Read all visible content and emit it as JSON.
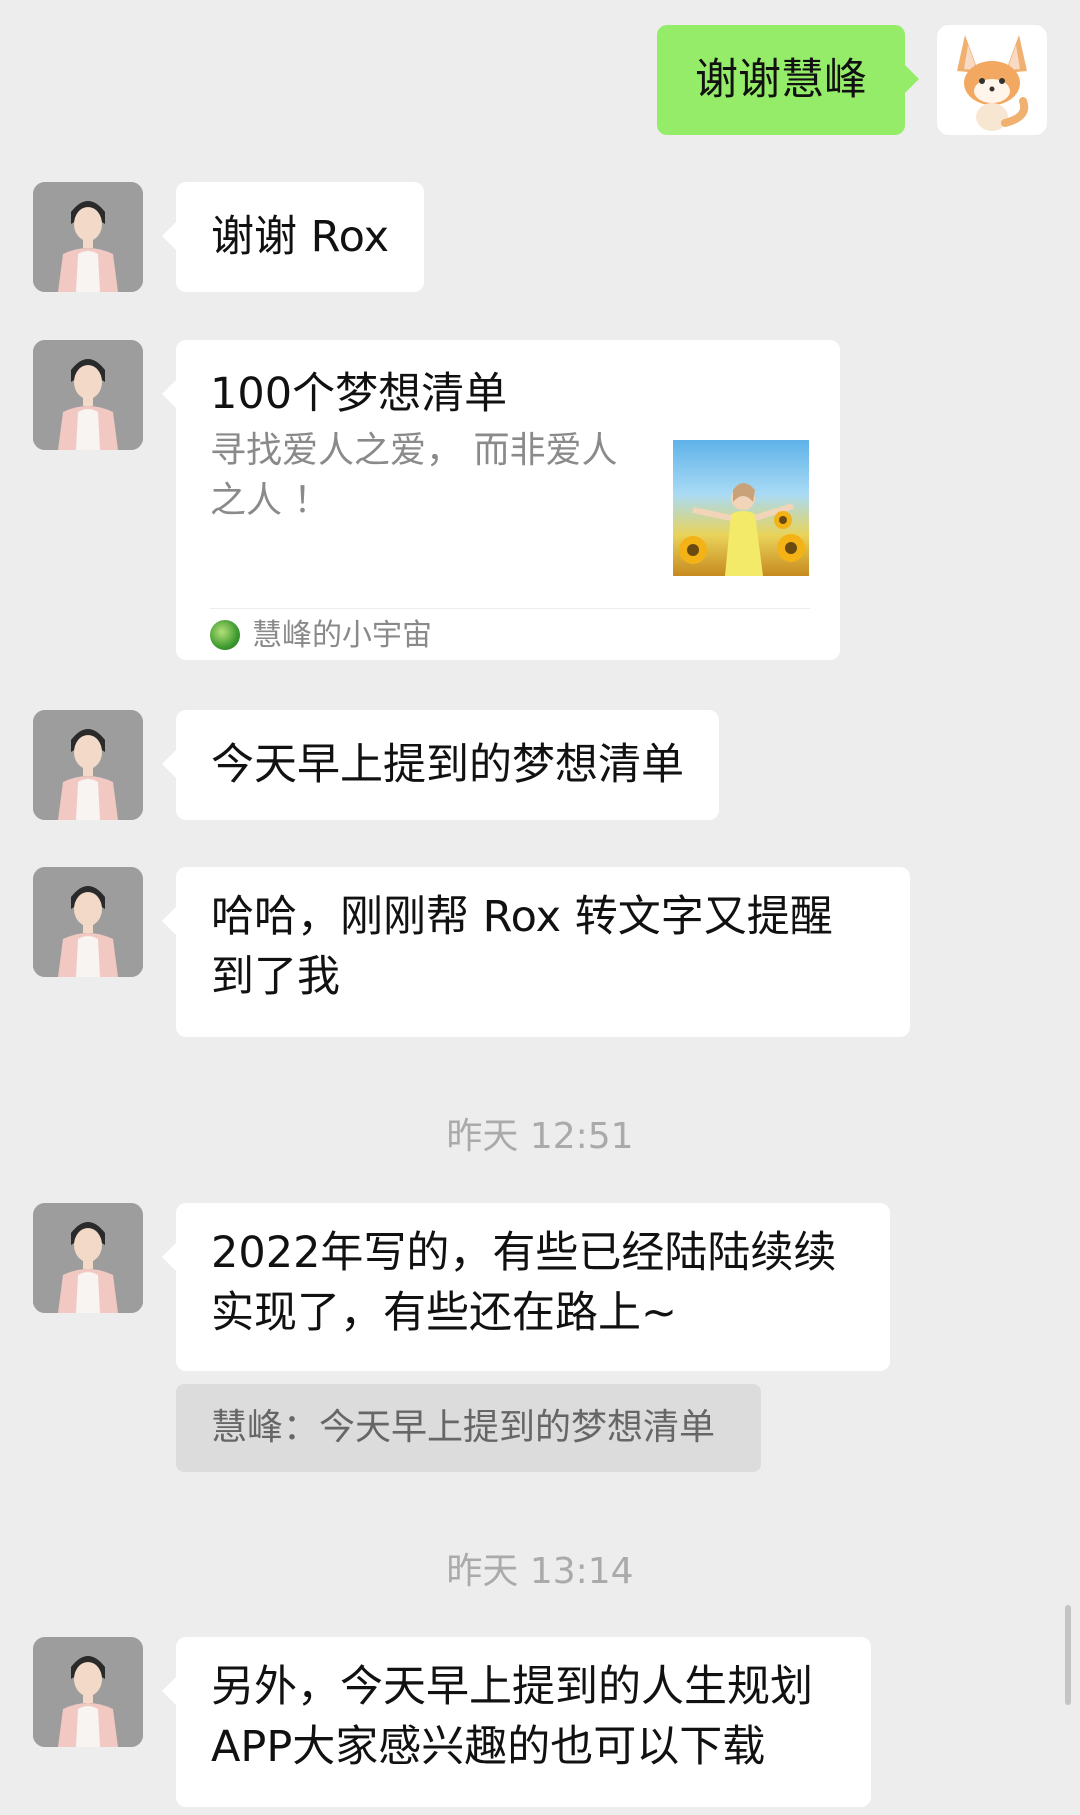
{
  "messages": {
    "m1": {
      "text": "谢谢慧峰"
    },
    "m2": {
      "text": "谢谢 Rox"
    },
    "card": {
      "title": "100个梦想清单",
      "description": "寻找爱人之爱， 而非爱人之人 ！",
      "source": "慧峰的小宇宙"
    },
    "m4": {
      "text": "今天早上提到的梦想清单"
    },
    "m5": {
      "text": "哈哈，刚刚帮 Rox 转文字又提醒到了我"
    },
    "t1": "昨天 12:51",
    "m6": {
      "text": "2022年写的，有些已经陆陆续续实现了，有些还在路上~"
    },
    "quote": {
      "text": "慧峰：今天早上提到的梦想清单"
    },
    "t2": "昨天 13:14",
    "m7": {
      "text": "另外，今天早上提到的人生规划APP大家感兴趣的也可以下载"
    }
  },
  "colors": {
    "background": "#ededed",
    "sent_bubble": "#95ec69",
    "received_bubble": "#ffffff",
    "timestamp": "#aaaaaa"
  }
}
